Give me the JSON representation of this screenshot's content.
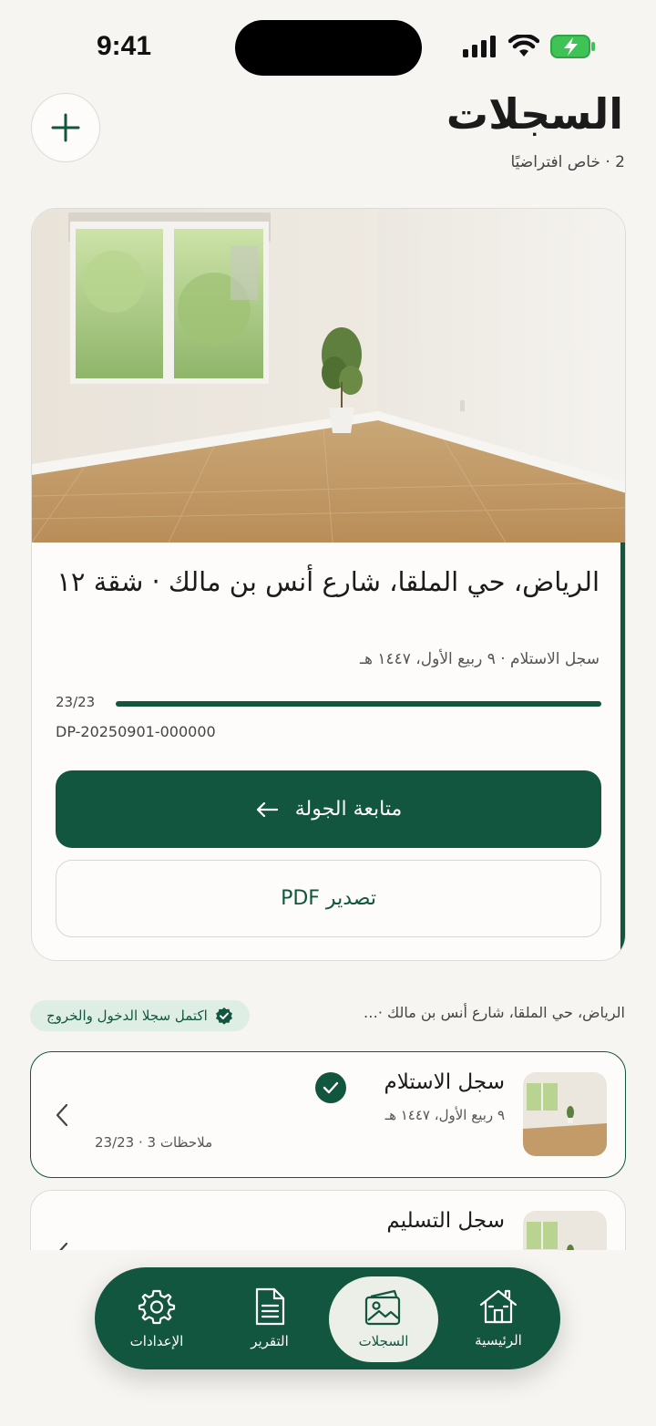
{
  "status_bar": {
    "time": "9:41"
  },
  "header": {
    "title": "السجلات",
    "subtitle": "2 · خاص افتراضيًا"
  },
  "hero": {
    "address": "الرياض، حي الملقا، شارع أنس بن مالك · شقة ١٢",
    "meta": "سجل الاستلام · ٩ ربيع الأول، ١٤٤٧ هـ",
    "progress_label": "23/23",
    "progress_fraction": 1.0,
    "record_id": "DP-20250901-000000",
    "primary_label": "متابعة الجولة",
    "secondary_label": "تصدير PDF"
  },
  "section": {
    "badge_label": "اكتمل سجلا الدخول والخروج",
    "address_short": "الرياض، حي الملقا، شارع أنس بن مالك ·…"
  },
  "records": [
    {
      "title": "سجل الاستلام",
      "date": "٩ ربيع الأول، ١٤٤٧ هـ",
      "stats": "ملاحظات 3 · 23/23"
    },
    {
      "title": "سجل التسليم"
    }
  ],
  "tabs": [
    {
      "label": "الرئيسية",
      "icon": "home-icon"
    },
    {
      "label": "السجلات",
      "icon": "photos-icon"
    },
    {
      "label": "التقرير",
      "icon": "document-icon"
    },
    {
      "label": "الإعدادات",
      "icon": "gear-icon"
    }
  ],
  "colors": {
    "brand": "#12563f",
    "background": "#f6f5f1",
    "card": "#fdfcfa"
  }
}
